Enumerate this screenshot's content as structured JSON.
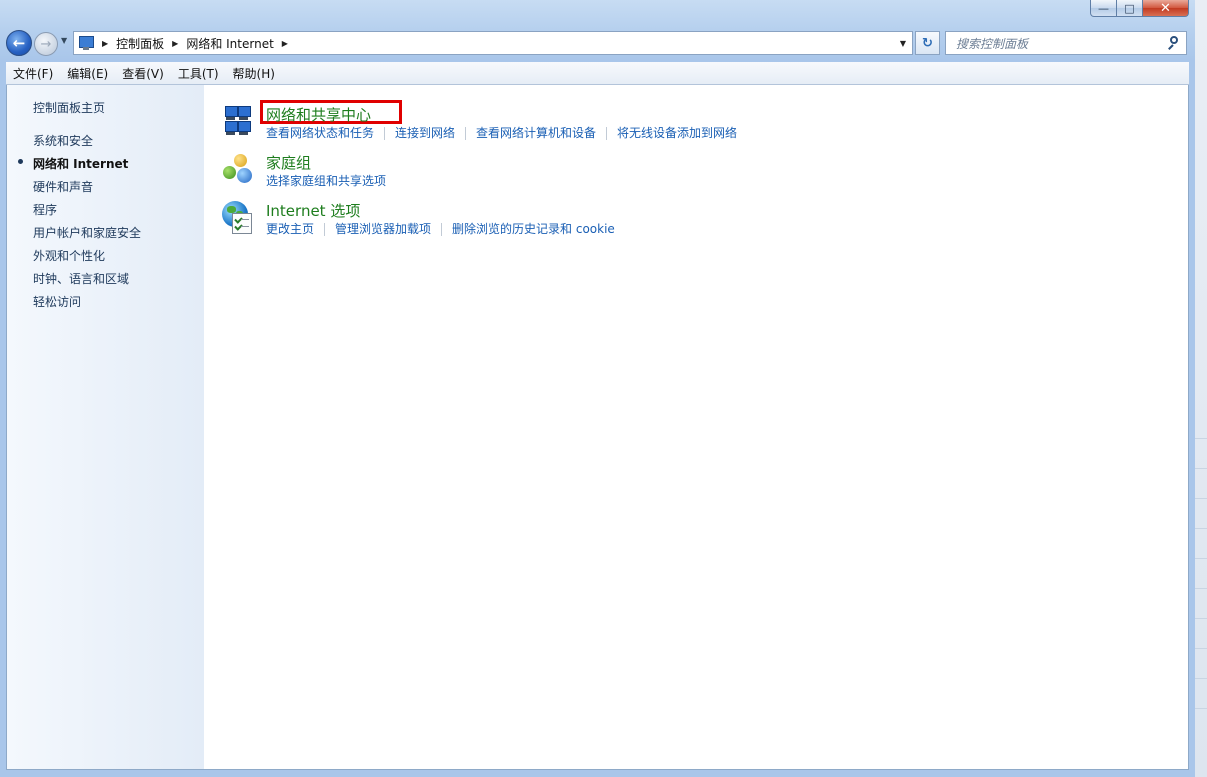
{
  "window": {
    "caption": {
      "minimize": "—",
      "maximize": "□",
      "close": "✕"
    }
  },
  "navigation": {
    "back_glyph": "←",
    "forward_glyph": "→",
    "breadcrumbs": [
      "控制面板",
      "网络和 Internet"
    ],
    "search_placeholder": "搜索控制面板",
    "refresh_glyph": "↻"
  },
  "menubar": {
    "items": [
      "文件(F)",
      "编辑(E)",
      "查看(V)",
      "工具(T)",
      "帮助(H)"
    ]
  },
  "sidebar": {
    "home": "控制面板主页",
    "items": [
      {
        "label": "系统和安全",
        "active": false
      },
      {
        "label": "网络和 Internet",
        "active": true
      },
      {
        "label": "硬件和声音",
        "active": false
      },
      {
        "label": "程序",
        "active": false
      },
      {
        "label": "用户帐户和家庭安全",
        "active": false
      },
      {
        "label": "外观和个性化",
        "active": false
      },
      {
        "label": "时钟、语言和区域",
        "active": false
      },
      {
        "label": "轻松访问",
        "active": false
      }
    ]
  },
  "categories": [
    {
      "title": "网络和共享中心",
      "icon": "network-icon",
      "highlighted": true,
      "links": [
        "查看网络状态和任务",
        "连接到网络",
        "查看网络计算机和设备",
        "将无线设备添加到网络"
      ]
    },
    {
      "title": "家庭组",
      "icon": "homegroup-icon",
      "highlighted": false,
      "links": [
        "选择家庭组和共享选项"
      ]
    },
    {
      "title": "Internet 选项",
      "icon": "internet-options-icon",
      "highlighted": false,
      "links": [
        "更改主页",
        "管理浏览器加载项",
        "删除浏览的历史记录和 cookie"
      ]
    }
  ],
  "colors": {
    "category_title": "#1e7d1e",
    "link": "#1a5fb4",
    "highlight_box": "#e00000"
  }
}
